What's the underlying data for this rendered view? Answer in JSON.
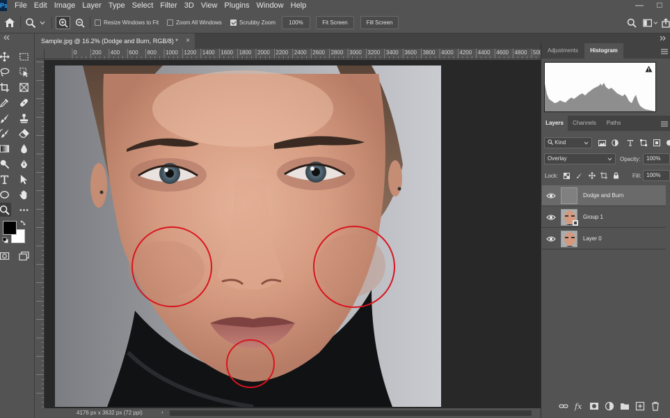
{
  "menubar": {
    "logo": "Ps",
    "items": [
      "File",
      "Edit",
      "Image",
      "Layer",
      "Type",
      "Select",
      "Filter",
      "3D",
      "View",
      "Plugins",
      "Window",
      "Help"
    ],
    "minimize": "—",
    "maximize": "□"
  },
  "options_bar": {
    "resize_windows_label": "Resize Windows to Fit",
    "zoom_all_label": "Zoom All Windows",
    "scrubby_zoom_label": "Scrubby Zoom",
    "zoom_value": "100%",
    "fit_screen_label": "Fit Screen",
    "fill_screen_label": "Fill Screen",
    "resize_windows_checked": false,
    "zoom_all_checked": false,
    "scrubby_zoom_checked": true
  },
  "document": {
    "tab_title": "Sample.jpg @ 16.2% (Dodge and Burn, RGB/8) *",
    "close_glyph": "×",
    "ruler_ticks": [
      "0",
      "200",
      "400",
      "600",
      "800",
      "1000",
      "1200",
      "1400",
      "1600",
      "1800",
      "2000",
      "2200",
      "2400",
      "2600",
      "2800",
      "3000",
      "3200",
      "3400",
      "3600",
      "3800",
      "4000",
      "4200",
      "4400",
      "4600",
      "4800",
      "5000",
      "52"
    ],
    "status_text": "4176 px x 3632 px (72 ppi)",
    "status_arrow": "›"
  },
  "panels": {
    "top_tabs": [
      "Adjustments",
      "Histogram"
    ],
    "top_active": "Histogram",
    "layer_tabs": [
      "Layers",
      "Channels",
      "Paths"
    ],
    "layer_active": "Layers",
    "kind_label": "Kind",
    "blend_mode": "Overlay",
    "opacity_label": "Opacity:",
    "opacity_value": "100%",
    "lock_label": "Lock:",
    "fill_label": "Fill:",
    "fill_value": "100%",
    "layers": [
      {
        "name": "Dodge and Burn",
        "selected": true
      },
      {
        "name": "Group 1",
        "selected": false
      },
      {
        "name": "Layer 0",
        "selected": false
      }
    ]
  },
  "colors": {
    "ui_bg": "#535353",
    "tab_dark": "#424242",
    "canvas_bg": "#282828",
    "selection": "#6a6a6a",
    "circle_stroke": "#d9141f"
  },
  "icons": {
    "home": "home-icon",
    "zoom": "magnifier-icon",
    "zoom_in": "zoom-in-icon",
    "zoom_out": "zoom-out-icon",
    "search": "search-icon",
    "workspace": "workspace-icon",
    "share": "share-icon"
  }
}
